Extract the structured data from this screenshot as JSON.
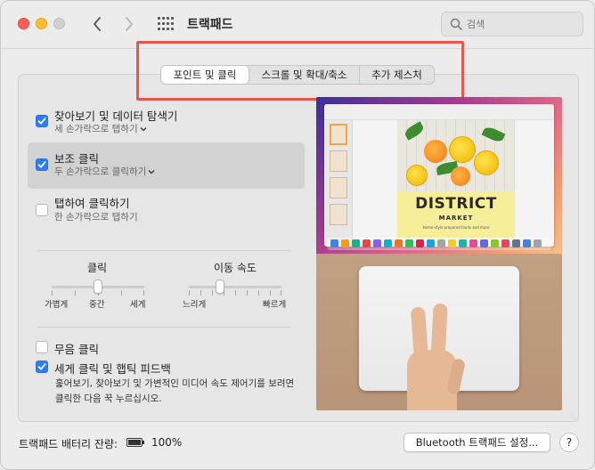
{
  "window": {
    "title": "트랙패드",
    "search_placeholder": "검색"
  },
  "tabs": [
    {
      "label": "포인트 및 클릭",
      "selected": true
    },
    {
      "label": "스크롤 및 확대/축소",
      "selected": false
    },
    {
      "label": "추가 제스처",
      "selected": false
    }
  ],
  "options": [
    {
      "label": "찾아보기 및 데이터 탐색기",
      "sub": "세 손가락으로 탭하기",
      "checked": true,
      "has_dropdown": true
    },
    {
      "label": "보조 클릭",
      "sub": "두 손가락으로 클릭하기",
      "checked": true,
      "has_dropdown": true,
      "selected": true
    },
    {
      "label": "탭하여 클릭하기",
      "sub": "한 손가락으로 탭하기",
      "checked": false,
      "has_dropdown": false
    }
  ],
  "sliders": {
    "click": {
      "title": "클릭",
      "labels": [
        "가볍게",
        "중간",
        "세게"
      ],
      "value_fraction": 0.5
    },
    "tracking": {
      "title": "이동 속도",
      "labels": [
        "느리게",
        "빠르게"
      ],
      "value_fraction": 0.33
    }
  },
  "bottom_options": [
    {
      "label": "무음 클릭",
      "checked": false
    },
    {
      "label": "세게 클릭 및 햅틱 피드백",
      "checked": true
    }
  ],
  "description": "훑어보기, 찾아보기 및 가변적인 미디어 속도 제어기를 보려면 클릭한 다음 꾹 누르십시오.",
  "preview": {
    "poster_title": "DISTRICT",
    "poster_subtitle": "MARKET",
    "poster_tagline": "Home-style prepared foods and more"
  },
  "footer": {
    "battery_label": "트랙패드 배터리 잔량:",
    "battery_pct": "100%",
    "battery_fraction": 1.0,
    "bluetooth_button": "Bluetooth 트랙패드 설정...",
    "help_button": "?"
  },
  "colors": {
    "accent": "#2f7df6",
    "highlight": "#e8574f",
    "close": "#fe5f57",
    "minimize": "#febc2e"
  }
}
